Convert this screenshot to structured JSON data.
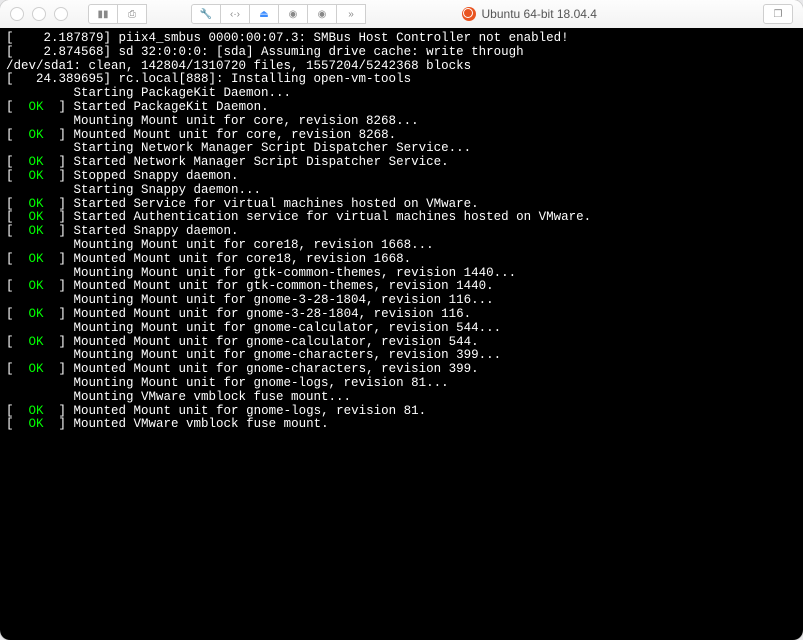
{
  "window": {
    "title": "Ubuntu 64-bit 18.04.4"
  },
  "toolbar": {
    "icons": [
      "pause",
      "snapshot",
      "wrench",
      "angles",
      "hdd",
      "shutdown1",
      "shutdown2",
      "more"
    ],
    "right_icon": "clone"
  },
  "boot_lines": [
    {
      "prefix": "[    2.187879] ",
      "text": "piix4_smbus 0000:00:07.3: SMBus Host Controller not enabled!"
    },
    {
      "prefix": "[    2.874568] ",
      "text": "sd 32:0:0:0: [sda] Assuming drive cache: write through"
    },
    {
      "prefix": "",
      "text": "/dev/sda1: clean, 142804/1310720 files, 1557204/5242368 blocks"
    },
    {
      "prefix": "[   24.389695] ",
      "text": "rc.local[888]: Installing open-vm-tools"
    },
    {
      "status": "plain",
      "text": "         Starting PackageKit Daemon..."
    },
    {
      "status": "ok",
      "text": "Started PackageKit Daemon."
    },
    {
      "status": "plain",
      "text": "         Mounting Mount unit for core, revision 8268..."
    },
    {
      "status": "ok",
      "text": "Mounted Mount unit for core, revision 8268."
    },
    {
      "status": "plain",
      "text": "         Starting Network Manager Script Dispatcher Service..."
    },
    {
      "status": "ok",
      "text": "Started Network Manager Script Dispatcher Service."
    },
    {
      "status": "ok",
      "text": "Stopped Snappy daemon."
    },
    {
      "status": "plain",
      "text": "         Starting Snappy daemon..."
    },
    {
      "status": "ok",
      "text": "Started Service for virtual machines hosted on VMware."
    },
    {
      "status": "ok",
      "text": "Started Authentication service for virtual machines hosted on VMware."
    },
    {
      "status": "ok",
      "text": "Started Snappy daemon."
    },
    {
      "status": "plain",
      "text": "         Mounting Mount unit for core18, revision 1668..."
    },
    {
      "status": "ok",
      "text": "Mounted Mount unit for core18, revision 1668."
    },
    {
      "status": "plain",
      "text": "         Mounting Mount unit for gtk-common-themes, revision 1440..."
    },
    {
      "status": "ok",
      "text": "Mounted Mount unit for gtk-common-themes, revision 1440."
    },
    {
      "status": "plain",
      "text": "         Mounting Mount unit for gnome-3-28-1804, revision 116..."
    },
    {
      "status": "ok",
      "text": "Mounted Mount unit for gnome-3-28-1804, revision 116."
    },
    {
      "status": "plain",
      "text": "         Mounting Mount unit for gnome-calculator, revision 544..."
    },
    {
      "status": "ok",
      "text": "Mounted Mount unit for gnome-calculator, revision 544."
    },
    {
      "status": "plain",
      "text": "         Mounting Mount unit for gnome-characters, revision 399..."
    },
    {
      "status": "ok",
      "text": "Mounted Mount unit for gnome-characters, revision 399."
    },
    {
      "status": "plain",
      "text": "         Mounting Mount unit for gnome-logs, revision 81..."
    },
    {
      "status": "plain",
      "text": "         Mounting VMware vmblock fuse mount..."
    },
    {
      "status": "ok",
      "text": "Mounted Mount unit for gnome-logs, revision 81."
    },
    {
      "status": "ok",
      "text": "Mounted VMware vmblock fuse mount."
    }
  ],
  "status_tokens": {
    "ok": "OK"
  }
}
